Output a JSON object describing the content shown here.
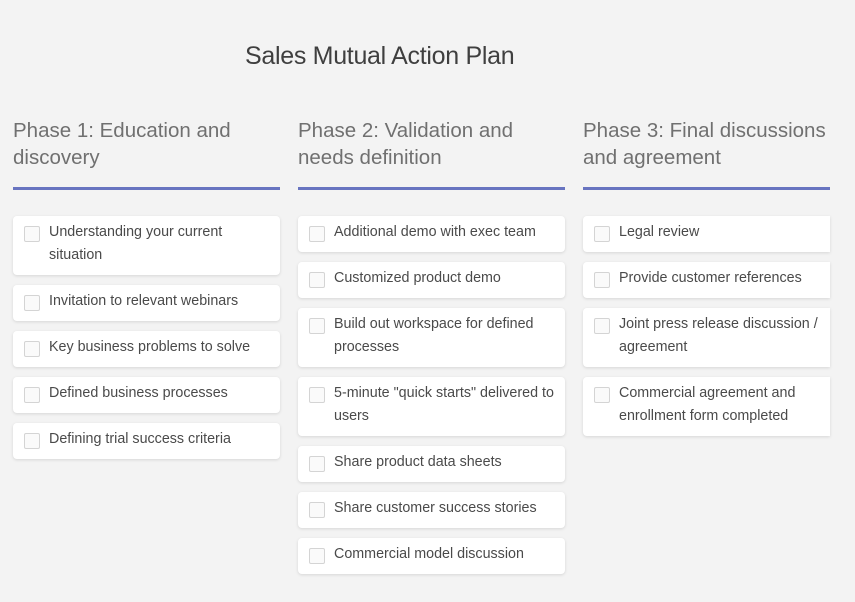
{
  "page": {
    "title": "Sales Mutual Action Plan"
  },
  "theme": {
    "accent": "#6874c0",
    "background": "#f3f3f3",
    "card": "#ffffff"
  },
  "phases": [
    {
      "title": "Phase 1: Education and discovery",
      "title_lines": [
        "Phase 1: Education and",
        "discovery"
      ],
      "tasks": [
        {
          "label": "Understanding your current situation",
          "checked": false
        },
        {
          "label": "Invitation to relevant webinars",
          "checked": false
        },
        {
          "label": "Key business problems to solve",
          "checked": false
        },
        {
          "label": "Defined business processes",
          "checked": false
        },
        {
          "label": "Defining trial success criteria",
          "checked": false
        }
      ]
    },
    {
      "title": "Phase 2: Validation and needs definition",
      "title_lines": [
        "Phase 2: Validation and",
        "needs definition"
      ],
      "tasks": [
        {
          "label": "Additional demo with exec team",
          "checked": false
        },
        {
          "label": "Customized product demo",
          "checked": false
        },
        {
          "label": "Build out workspace for defined processes",
          "checked": false
        },
        {
          "label": "5-minute \"quick starts\" delivered to users",
          "checked": false
        },
        {
          "label": "Share product data sheets",
          "checked": false
        },
        {
          "label": "Share customer success stories",
          "checked": false
        },
        {
          "label": "Commercial model discussion",
          "checked": false
        }
      ]
    },
    {
      "title": "Phase 3: Final discussions and agreement",
      "title_lines": [
        "Phase 3: Final discussions",
        "and agreement"
      ],
      "tasks": [
        {
          "label": "Legal review",
          "checked": false
        },
        {
          "label": "Provide customer references",
          "checked": false
        },
        {
          "label": "Joint press release discussion / agreement",
          "checked": false
        },
        {
          "label": "Commercial agreement and enrollment form completed",
          "checked": false
        }
      ]
    }
  ]
}
